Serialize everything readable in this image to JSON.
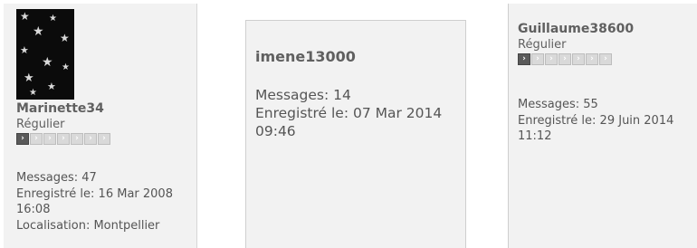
{
  "posts": [
    {
      "username": "Marinette34",
      "rank": "Régulier",
      "badges": [
        "›",
        "›",
        "›",
        "›",
        "›",
        "›",
        "›"
      ],
      "info": {
        "messages": "Messages: 47",
        "registered": "Enregistré le: 16 Mar 2008",
        "registered_time": "16:08",
        "location": "Localisation: Montpellier"
      }
    },
    {
      "username": "imene13000",
      "info": {
        "messages": "Messages: 14",
        "registered": "Enregistré le: 07 Mar 2014",
        "registered_time": "09:46"
      }
    },
    {
      "username": "Guillaume38600",
      "rank": "Régulier",
      "badges": [
        "›",
        "›",
        "›",
        "›",
        "›",
        "›",
        "›"
      ],
      "info": {
        "messages": "Messages: 55",
        "registered": "Enregistré le: 29 Juin 2014",
        "registered_time": "11:12"
      }
    }
  ],
  "colors": {
    "card_background": "#f2f2f2",
    "badge_active": "#5a5a5a",
    "badge_inactive": "#d9d9d9",
    "text": "#555555"
  },
  "icons": {
    "avatar": "star-pattern-avatar",
    "badge": "chevron-right-icon"
  }
}
